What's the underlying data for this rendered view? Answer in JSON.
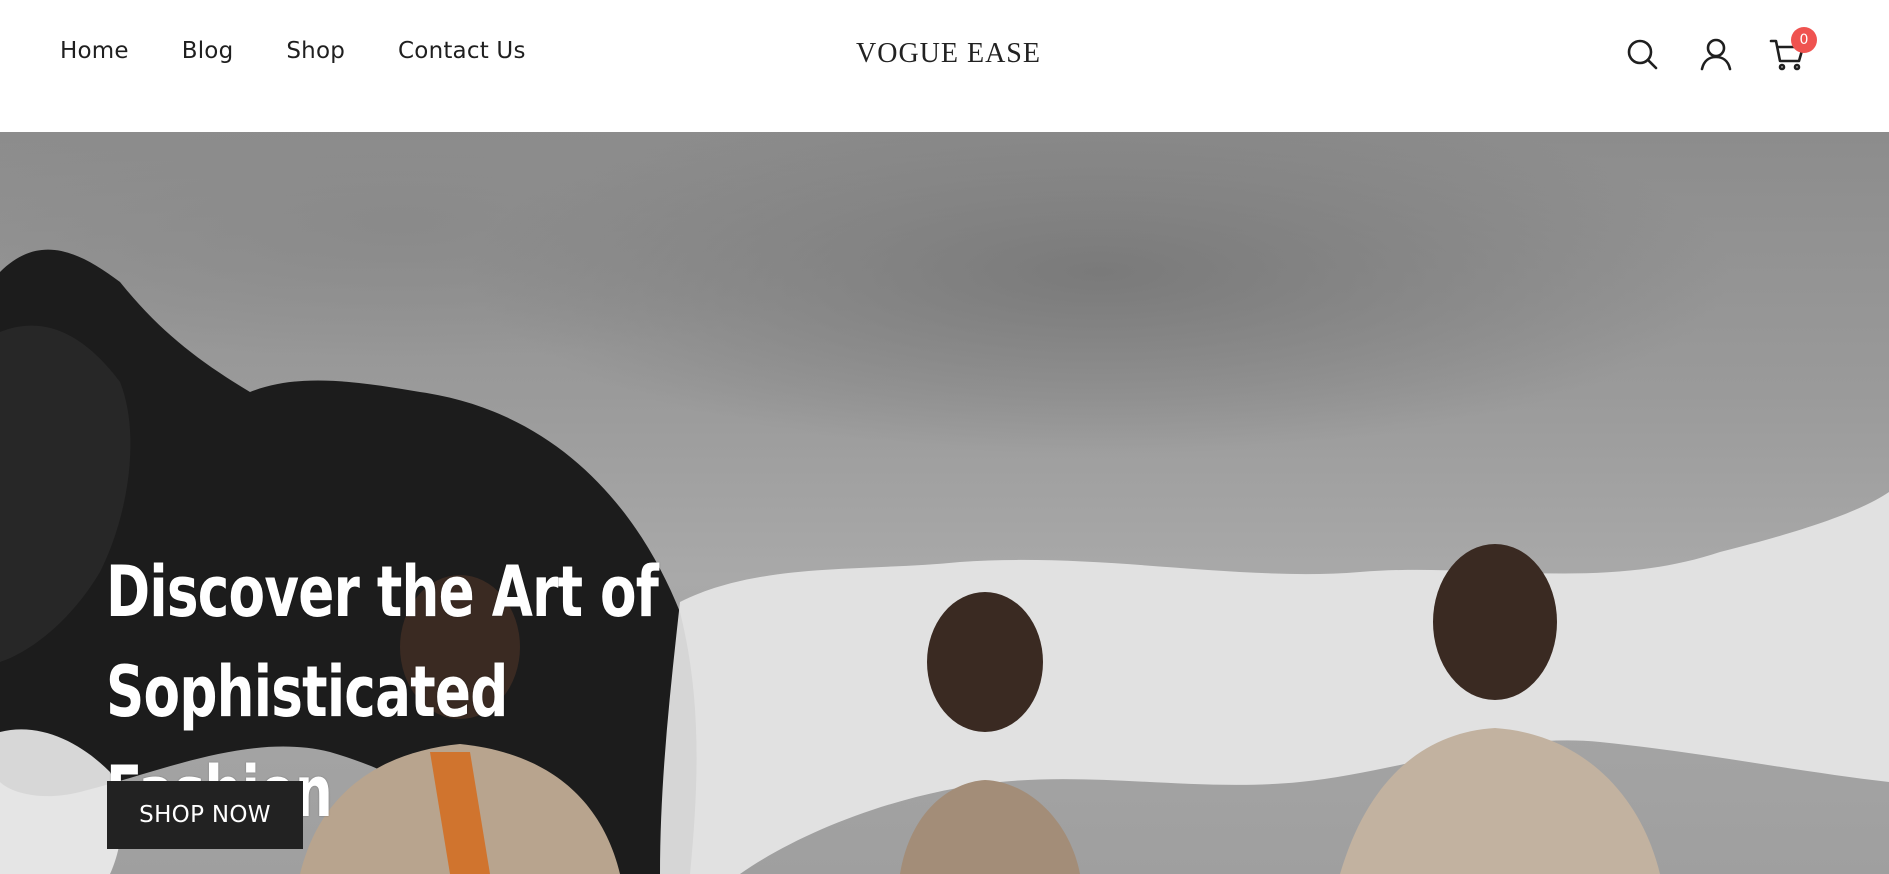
{
  "header": {
    "nav": [
      {
        "label": "Home"
      },
      {
        "label": "Blog"
      },
      {
        "label": "Shop"
      },
      {
        "label": "Contact Us"
      }
    ],
    "logo": "VOGUE EASE",
    "icons": {
      "search": "search-icon",
      "account": "user-icon",
      "cart": "cart-icon"
    },
    "cart_count": "0"
  },
  "hero": {
    "title_line1": "Discover the Art of Sophisticated",
    "title_line2": "Fashion",
    "cta_label": "SHOP NOW"
  },
  "colors": {
    "badge": "#ef5350",
    "cta_bg": "#222222",
    "text": "#1f1f1f"
  }
}
